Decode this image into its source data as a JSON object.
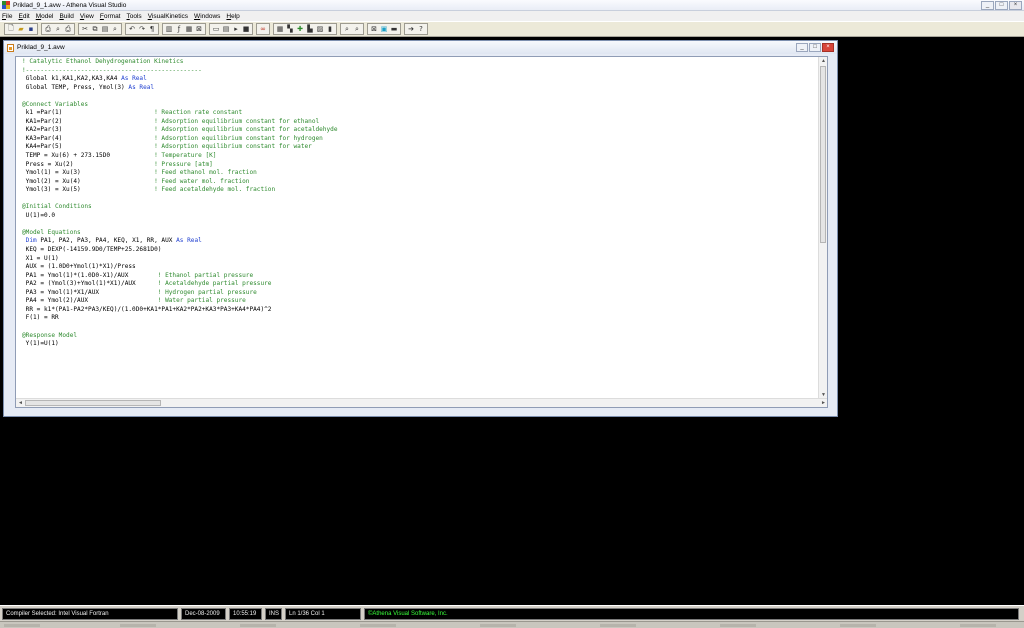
{
  "app": {
    "title": "Priklad_9_1.avw - Athena Visual Studio"
  },
  "window_controls": {
    "minimize": "_",
    "maximize": "□",
    "close": "×"
  },
  "menu": {
    "items": [
      "File",
      "Edit",
      "Model",
      "Build",
      "View",
      "Format",
      "Tools",
      "VisualKinetics",
      "Windows",
      "Help"
    ]
  },
  "toolbar": {
    "icons": [
      "new-file-icon",
      "open-folder-icon",
      "save-icon",
      "print-icon",
      "print-preview-icon",
      "printer-setup-icon",
      "cut-icon",
      "copy-icon",
      "paste-icon",
      "find-icon",
      "undo-icon",
      "redo-icon",
      "paragraph-icon",
      "bold-icon",
      "function-icon",
      "grid-icon",
      "table-icon",
      "window-icon",
      "list-icon",
      "step-icon",
      "link-icon",
      "calculator-icon",
      "chart-icon",
      "chart-bar-icon",
      "measure-icon",
      "zoom-icon",
      "zoom-out-icon",
      "spectrum-icon",
      "image-icon",
      "film-icon",
      "run-icon",
      "help-icon"
    ]
  },
  "document": {
    "title": "Priklad_9_1.avw",
    "lines": [
      [
        {
          "t": "! Catalytic Ethanol Dehydrogenation Kinetics",
          "c": "g"
        }
      ],
      [
        {
          "t": "!------------------------------------------------",
          "c": "g"
        }
      ],
      [
        {
          "t": " Global k1,KA1,KA2,KA3,KA4 ",
          "c": "k"
        },
        {
          "t": "As Real",
          "c": "b"
        }
      ],
      [
        {
          "t": " Global TEMP, Press, Ymol(3) ",
          "c": "k"
        },
        {
          "t": "As Real",
          "c": "b"
        }
      ],
      [
        {
          "t": "",
          "c": "k"
        }
      ],
      [
        {
          "t": "@Connect Variables",
          "c": "g"
        }
      ],
      [
        {
          "t": " k1 =Par(1)                         ",
          "c": "k"
        },
        {
          "t": "! Reaction rate constant",
          "c": "g"
        }
      ],
      [
        {
          "t": " KA1=Par(2)                         ",
          "c": "k"
        },
        {
          "t": "! Adsorption equilibrium constant for ethanol",
          "c": "g"
        }
      ],
      [
        {
          "t": " KA2=Par(3)                         ",
          "c": "k"
        },
        {
          "t": "! Adsorption equilibrium constant for acetaldehyde",
          "c": "g"
        }
      ],
      [
        {
          "t": " KA3=Par(4)                         ",
          "c": "k"
        },
        {
          "t": "! Adsorption equilibrium constant for hydrogen",
          "c": "g"
        }
      ],
      [
        {
          "t": " KA4=Par(5)                         ",
          "c": "k"
        },
        {
          "t": "! Adsorption equilibrium constant for water",
          "c": "g"
        }
      ],
      [
        {
          "t": " TEMP = Xu(6) + 273.15D0            ",
          "c": "k"
        },
        {
          "t": "! Temperature [K]",
          "c": "g"
        }
      ],
      [
        {
          "t": " Press = Xu(2)                      ",
          "c": "k"
        },
        {
          "t": "! Pressure [atm]",
          "c": "g"
        }
      ],
      [
        {
          "t": " Ymol(1) = Xu(3)                    ",
          "c": "k"
        },
        {
          "t": "! Feed ethanol mol. fraction",
          "c": "g"
        }
      ],
      [
        {
          "t": " Ymol(2) = Xu(4)                    ",
          "c": "k"
        },
        {
          "t": "! Feed water mol. fraction",
          "c": "g"
        }
      ],
      [
        {
          "t": " Ymol(3) = Xu(5)                    ",
          "c": "k"
        },
        {
          "t": "! Feed acetaldehyde mol. fraction",
          "c": "g"
        }
      ],
      [
        {
          "t": "",
          "c": "k"
        }
      ],
      [
        {
          "t": "@Initial Conditions",
          "c": "g"
        }
      ],
      [
        {
          "t": " U(1)=0.0",
          "c": "k"
        }
      ],
      [
        {
          "t": "",
          "c": "k"
        }
      ],
      [
        {
          "t": "@Model Equations",
          "c": "g"
        }
      ],
      [
        {
          "t": " ",
          "c": "k"
        },
        {
          "t": "Dim",
          "c": "b"
        },
        {
          "t": " PA1, PA2, PA3, PA4, KEQ, X1, RR, AUX ",
          "c": "k"
        },
        {
          "t": "As Real",
          "c": "b"
        }
      ],
      [
        {
          "t": " KEQ = DEXP(-14159.9D0/TEMP+25.2681D0)",
          "c": "k"
        }
      ],
      [
        {
          "t": " X1 = U(1)",
          "c": "k"
        }
      ],
      [
        {
          "t": " AUX = (1.0D0+Ymol(1)*X1)/Press",
          "c": "k"
        }
      ],
      [
        {
          "t": " PA1 = Ymol(1)*(1.0D0-X1)/AUX        ",
          "c": "k"
        },
        {
          "t": "! Ethanol partial pressure",
          "c": "g"
        }
      ],
      [
        {
          "t": " PA2 = (Ymol(3)+Ymol(1)*X1)/AUX      ",
          "c": "k"
        },
        {
          "t": "! Acetaldehyde partial pressure",
          "c": "g"
        }
      ],
      [
        {
          "t": " PA3 = Ymol(1)*X1/AUX                ",
          "c": "k"
        },
        {
          "t": "! Hydrogen partial pressure",
          "c": "g"
        }
      ],
      [
        {
          "t": " PA4 = Ymol(2)/AUX                   ",
          "c": "k"
        },
        {
          "t": "! Water partial pressure",
          "c": "g"
        }
      ],
      [
        {
          "t": " RR = k1*(PA1-PA2*PA3/KEQ)/(1.0D0+KA1*PA1+KA2*PA2+KA3*PA3+KA4*PA4)^2",
          "c": "k"
        }
      ],
      [
        {
          "t": " F(1) = RR",
          "c": "k"
        }
      ],
      [
        {
          "t": "",
          "c": "k"
        }
      ],
      [
        {
          "t": "@Response Model",
          "c": "g"
        }
      ],
      [
        {
          "t": " Y(1)=U(1)",
          "c": "k"
        }
      ]
    ]
  },
  "scroll": {
    "up": "▲",
    "down": "▼",
    "left": "◄",
    "right": "►"
  },
  "statusbar": {
    "compiler": "Compiler Selected:  Intel Visual Fortran",
    "date": "Dec-08-2009",
    "time": "10:55:19",
    "mode": "INS",
    "position": "Ln 1/36  Col 1",
    "company": "©Athena Visual Software, Inc."
  },
  "colors": {
    "comment": "#2e8a2e",
    "keyword": "#1f3fd0",
    "company_text": "#39ff3a"
  }
}
